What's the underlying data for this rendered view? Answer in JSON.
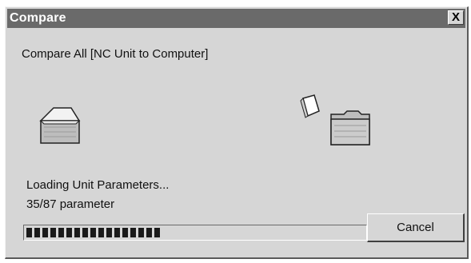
{
  "window": {
    "title": "Compare",
    "close_glyph": "X"
  },
  "main": {
    "heading": "Compare All [NC Unit to Computer]",
    "status_text": "Loading Unit Parameters...",
    "count_text": "35/87 parameter",
    "progress_fraction": 0.4023,
    "cancel_label": "Cancel"
  },
  "icons": {
    "source": "open-folder-icon",
    "moving": "document-icon",
    "target": "closed-folder-icon"
  },
  "colors": {
    "titlebar": "#6a6a6a",
    "dialog_bg": "#d6d6d6",
    "progress_blocks": "#1a1a1a"
  }
}
